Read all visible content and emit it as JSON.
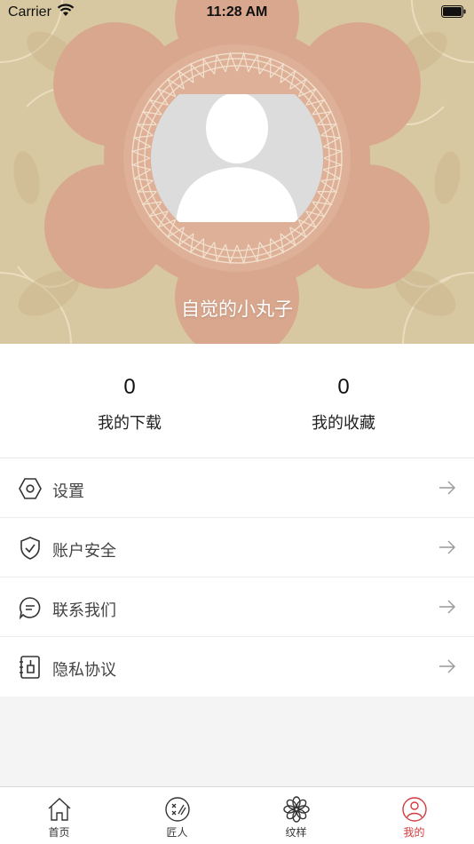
{
  "status_bar": {
    "carrier": "Carrier",
    "time": "11:28 AM"
  },
  "profile": {
    "username": "自觉的小丸子"
  },
  "stats": [
    {
      "value": "0",
      "label": "我的下载"
    },
    {
      "value": "0",
      "label": "我的收藏"
    }
  ],
  "menu": [
    {
      "label": "设置",
      "icon": "hexagon-settings-icon"
    },
    {
      "label": "账户安全",
      "icon": "shield-check-icon"
    },
    {
      "label": "联系我们",
      "icon": "chat-bubble-icon"
    },
    {
      "label": "隐私协议",
      "icon": "document-icon"
    }
  ],
  "tabs": [
    {
      "label": "首页",
      "icon": "home-icon"
    },
    {
      "label": "匠人",
      "icon": "craftsman-icon"
    },
    {
      "label": "纹样",
      "icon": "flower-pattern-icon"
    },
    {
      "label": "我的",
      "icon": "user-icon"
    }
  ],
  "colors": {
    "accent": "#d33a3a",
    "header_bg": "#d9c9a4",
    "pattern_rose": "#d9a48a"
  }
}
